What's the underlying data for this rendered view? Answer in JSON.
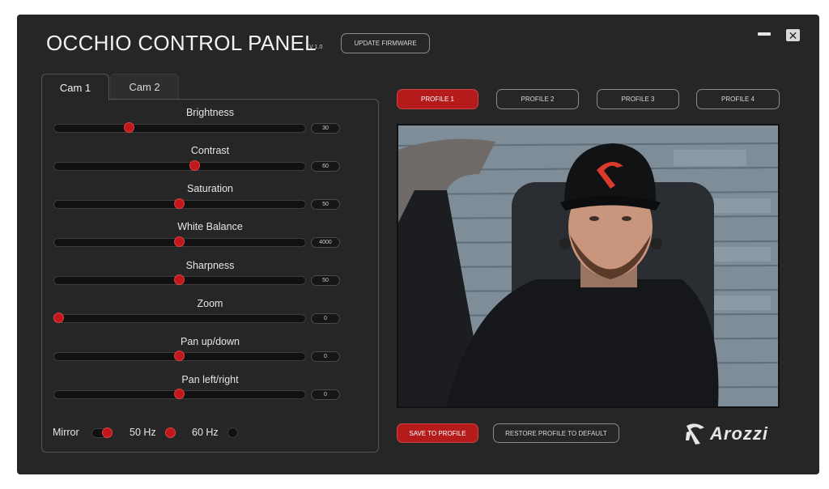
{
  "header": {
    "title": "OCCHIO CONTROL PANEL",
    "version": "V 1.0",
    "update_button": "UPDATE FIRMWARE"
  },
  "tabs": [
    {
      "label": "Cam 1",
      "active": true
    },
    {
      "label": "Cam 2",
      "active": false
    }
  ],
  "controls": [
    {
      "label": "Brightness",
      "value": "30",
      "position": 0.3
    },
    {
      "label": "Contrast",
      "value": "60",
      "position": 0.56
    },
    {
      "label": "Saturation",
      "value": "50",
      "position": 0.5
    },
    {
      "label": "White Balance",
      "value": "4000",
      "position": 0.5
    },
    {
      "label": "Sharpness",
      "value": "50",
      "position": 0.5
    },
    {
      "label": "Zoom",
      "value": "0",
      "position": 0.02
    },
    {
      "label": "Pan up/down",
      "value": "0",
      "position": 0.5
    },
    {
      "label": "Pan left/right",
      "value": "0",
      "position": 0.5
    }
  ],
  "options": {
    "mirror_label": "Mirror",
    "mirror_on": true,
    "hz50_label": "50 Hz",
    "hz50_selected": true,
    "hz60_label": "60 Hz",
    "hz60_selected": false
  },
  "profiles": [
    {
      "label": "PROFILE 1",
      "active": true
    },
    {
      "label": "PROFILE 2",
      "active": false
    },
    {
      "label": "PROFILE 3",
      "active": false
    },
    {
      "label": "PROFILE 4",
      "active": false
    }
  ],
  "actions": {
    "save": "SAVE TO PROFILE",
    "restore": "RESTORE PROFILE TO DEFAULT"
  },
  "brand": {
    "name": "Arozzi"
  },
  "colors": {
    "accent": "#b51b1b",
    "background": "#262626"
  }
}
